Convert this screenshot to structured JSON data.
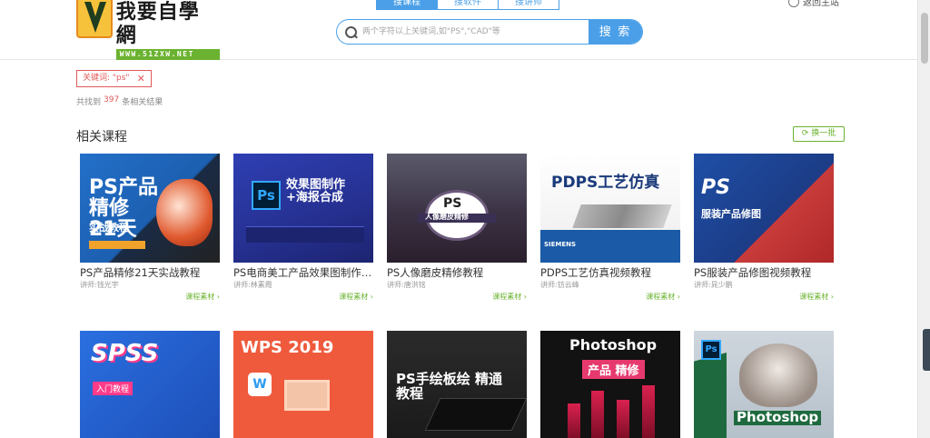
{
  "logo": {
    "name": "我要自學網",
    "url": "WWW.51ZXW.NET"
  },
  "search": {
    "tabs": [
      "搜课程",
      "搜软件",
      "搜讲师"
    ],
    "placeholder": "两个字符以上关键词,如\"PS\",\"CAD\"等",
    "button": "搜 索"
  },
  "header": {
    "back_home": "返回主站"
  },
  "filter": {
    "keyword_tag": "关键词: \"ps\"",
    "result_prefix": "共找到",
    "result_count": "397",
    "result_suffix": "条相关结果"
  },
  "section": {
    "title": "相关课程",
    "refresh": "换一批"
  },
  "courses": [
    {
      "title": "PS产品精修21天实战教程",
      "teacher": "讲师:钱光宇",
      "material": "课程素材 ›",
      "thumb_text": "PS产品精修 21天",
      "thumb_sub": "实战教程"
    },
    {
      "title": "PS电商美工产品效果图制作+海报合成",
      "teacher": "讲师:林素霞",
      "material": "课程素材 ›",
      "thumb_text": "效果图制作 +海报合成"
    },
    {
      "title": "PS人像磨皮精修教程",
      "teacher": "讲师:唐洪铭",
      "material": "课程素材 ›",
      "thumb_text": "PS",
      "thumb_sub": "人像磨皮精修"
    },
    {
      "title": "PDPS工艺仿真视频教程",
      "teacher": "讲师:钫云峰",
      "material": "课程素材 ›",
      "thumb_text": "PDPS工艺仿真",
      "thumb_sub": "SIEMENS"
    },
    {
      "title": "PS服装产品修图视频教程",
      "teacher": "讲师:晁少鹏",
      "material": "课程素材 ›",
      "thumb_text": "PS",
      "thumb_sub": "服装产品修图"
    },
    {
      "thumb_text": "SPSS",
      "thumb_sub": "入门教程"
    },
    {
      "thumb_text": "WPS 2019",
      "thumb_sub": "W"
    },
    {
      "thumb_text": "PS手绘板绘 精通教程"
    },
    {
      "thumb_text": "Photoshop",
      "thumb_sub": "产品 精修"
    },
    {
      "thumb_text": "Photoshop",
      "thumb_sub": "Ps"
    }
  ],
  "colors": {
    "accent": "#4a9fe8",
    "green": "#6ab22f",
    "red": "#e05a5a"
  }
}
